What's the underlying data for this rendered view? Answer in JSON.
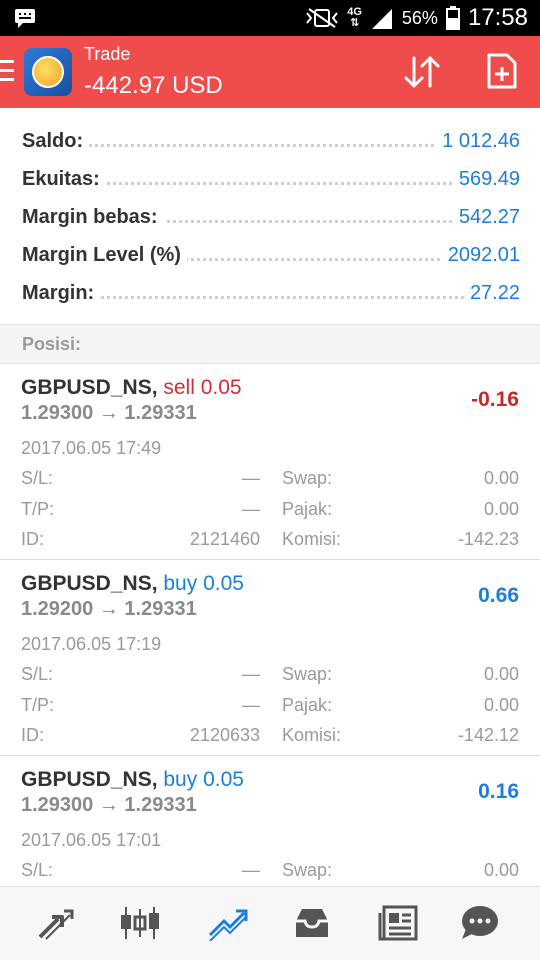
{
  "status_bar": {
    "network": "4G",
    "battery": "56%",
    "time": "17:58"
  },
  "header": {
    "title": "Trade",
    "balance": "-442.97 USD",
    "bg_color": "#ef4c4c",
    "icons": [
      "menu-icon",
      "app-logo",
      "sort-icon",
      "add-doc-icon"
    ]
  },
  "summary": [
    {
      "label": "Saldo:",
      "value": "1 012.46"
    },
    {
      "label": "Ekuitas:",
      "value": "569.49"
    },
    {
      "label": "Margin bebas:",
      "value": "542.27"
    },
    {
      "label": "Margin Level (%)",
      "value": "2092.01"
    },
    {
      "label": "Margin:",
      "value": "27.22"
    }
  ],
  "positions_header": "Posisi:",
  "positions": [
    {
      "symbol": "GBPUSD_NS,",
      "side": "sell 0.05",
      "prices": "1.29300 → 1.29331",
      "profit": "-0.16",
      "time": "2017.06.05 17:49",
      "sl_label": "S/L:",
      "sl": "—",
      "tp_label": "T/P:",
      "tp": "—",
      "id_label": "ID:",
      "id": "2121460",
      "swap_label": "Swap:",
      "swap": "0.00",
      "tax_label": "Pajak:",
      "tax": "0.00",
      "comm_label": "Komisi:",
      "comm": "-142.23"
    },
    {
      "symbol": "GBPUSD_NS,",
      "side": "buy 0.05",
      "prices": "1.29200 → 1.29331",
      "profit": "0.66",
      "time": "2017.06.05 17:19",
      "sl_label": "S/L:",
      "sl": "—",
      "tp_label": "T/P:",
      "tp": "—",
      "id_label": "ID:",
      "id": "2120633",
      "swap_label": "Swap:",
      "swap": "0.00",
      "tax_label": "Pajak:",
      "tax": "0.00",
      "comm_label": "Komisi:",
      "comm": "-142.12"
    },
    {
      "symbol": "GBPUSD_NS,",
      "side": "buy 0.05",
      "prices": "1.29300 → 1.29331",
      "profit": "0.16",
      "time": "2017.06.05 17:01",
      "sl_label": "S/L:",
      "sl": "—",
      "swap_label": "Swap:",
      "swap": "0.00"
    }
  ],
  "bottom_nav": [
    "quotes-icon",
    "chart-candles-icon",
    "trade-icon",
    "history-inbox-icon",
    "news-icon",
    "chat-icon"
  ],
  "colors": {
    "accent_blue": "#1a7fdc",
    "sell_red": "#d32f2f",
    "active_nav": "#1a7fdc",
    "inactive_nav": "#555555"
  }
}
